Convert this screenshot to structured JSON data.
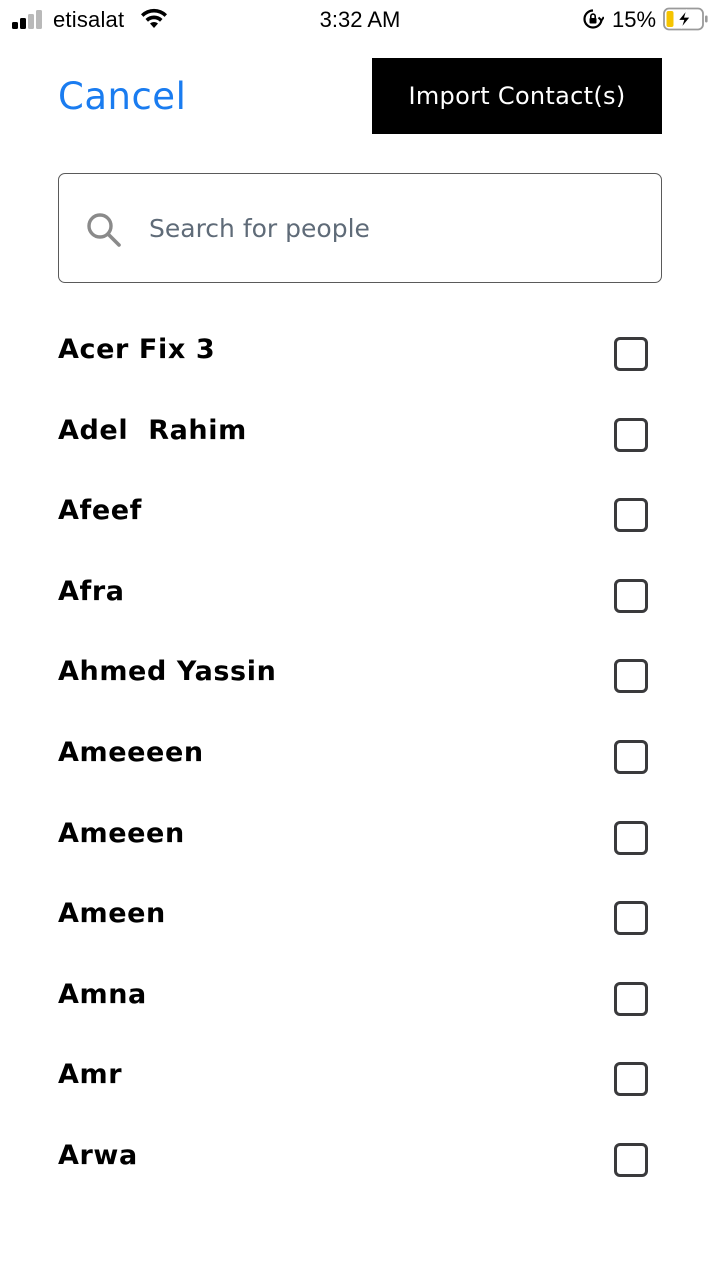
{
  "status_bar": {
    "carrier": "etisalat",
    "time": "3:32 AM",
    "battery_percent": "15%",
    "signal_icon": "cellular-signal-icon",
    "wifi_icon": "wifi-icon",
    "orientation_lock_icon": "rotation-lock-icon",
    "battery_icon": "battery-charging-icon",
    "battery_color": "#f5c400"
  },
  "header": {
    "cancel_label": "Cancel",
    "import_label": "Import Contact(s)",
    "accent_color": "#1a7cf0"
  },
  "search": {
    "placeholder": "Search for people",
    "value": "",
    "icon": "search-icon"
  },
  "contacts": [
    {
      "name": "Acer Fix 3",
      "checked": false
    },
    {
      "name": "Adel  Rahim",
      "checked": false
    },
    {
      "name": "Afeef",
      "checked": false
    },
    {
      "name": "Afra",
      "checked": false
    },
    {
      "name": "Ahmed Yassin",
      "checked": false
    },
    {
      "name": "Ameeeen",
      "checked": false
    },
    {
      "name": "Ameeen",
      "checked": false
    },
    {
      "name": "Ameen",
      "checked": false
    },
    {
      "name": "Amna",
      "checked": false
    },
    {
      "name": "Amr",
      "checked": false
    },
    {
      "name": "Arwa",
      "checked": false
    }
  ]
}
